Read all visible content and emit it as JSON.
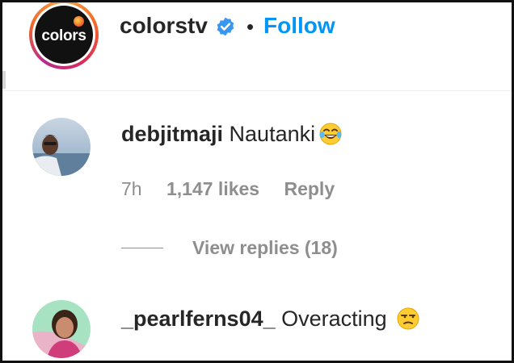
{
  "header": {
    "username": "colorstv",
    "separator": "•",
    "follow_label": "Follow",
    "logo_text": "colors",
    "verified_icon": "verified-badge-icon"
  },
  "comments": [
    {
      "username": "debjitmaji",
      "text": "Nautanki",
      "emoji": "face-with-tears-of-joy",
      "time": "7h",
      "likes": "1,147 likes",
      "reply_label": "Reply",
      "view_replies": "View replies (18)"
    },
    {
      "username": "_pearlferns04_",
      "text": "Overacting",
      "emoji": "unamused-face"
    }
  ],
  "colors": {
    "follow": "#0095f6",
    "text": "#262626",
    "secondary": "#8e8e8e",
    "verified": "#3897f0"
  }
}
